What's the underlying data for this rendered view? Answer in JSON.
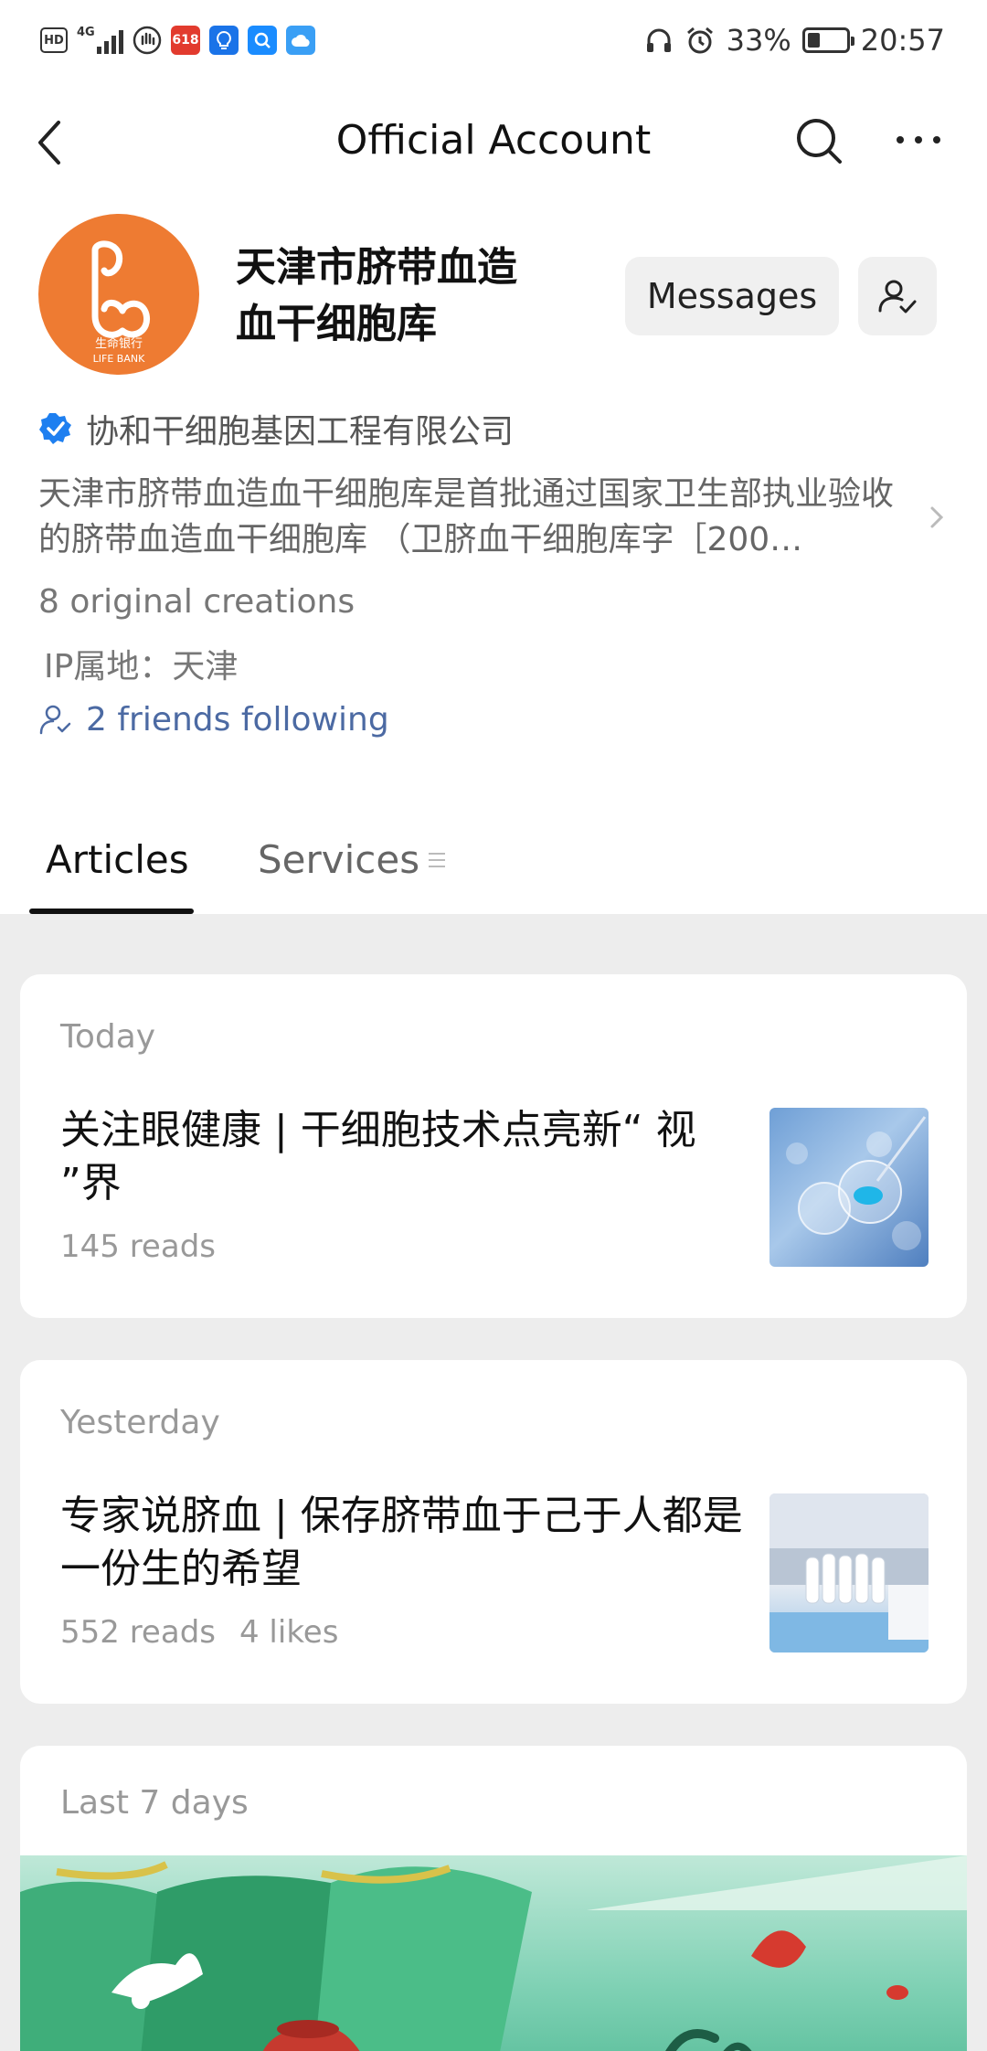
{
  "status_bar": {
    "left_icons": [
      "hd-icon",
      "4g-signal-icon",
      "hand-icon",
      "618-app-icon",
      "bulb-app-icon",
      "search-app-icon",
      "cloud-app-icon"
    ],
    "battery": "33%",
    "battery_level": 0.33,
    "time": "20:57"
  },
  "nav": {
    "title": "Official Account"
  },
  "account": {
    "name_line1": "天津市脐带血造",
    "name_line2": "血干细胞库",
    "avatar_brand_cn": "生命银行",
    "avatar_brand_en": "LIFE BANK",
    "messages_label": "Messages",
    "verified_company": "协和干细胞基因工程有限公司",
    "description": "天津市脐带血造血干细胞库是首批通过国家卫生部执业验收的脐带血造血干细胞库 （卫脐血干细胞库字［200…",
    "original_creations": "8 original creations",
    "ip_location": "IP属地：天津",
    "friends_following": "2 friends following"
  },
  "tabs": {
    "articles": "Articles",
    "services": "Services"
  },
  "articles": [
    {
      "date": "Today",
      "title": "关注眼健康 | 干细胞技术点亮新“ 视 ”界",
      "reads": "145 reads",
      "likes": ""
    },
    {
      "date": "Yesterday",
      "title": "专家说脐血 | 保存脐带血于己于人都是一份生的希望",
      "reads": "552 reads",
      "likes": "4 likes"
    },
    {
      "date": "Last 7 days"
    }
  ],
  "colors": {
    "accent_link": "#4c6aa3",
    "verified_blue": "#1e7ff0",
    "avatar_orange": "#ee7b32"
  }
}
